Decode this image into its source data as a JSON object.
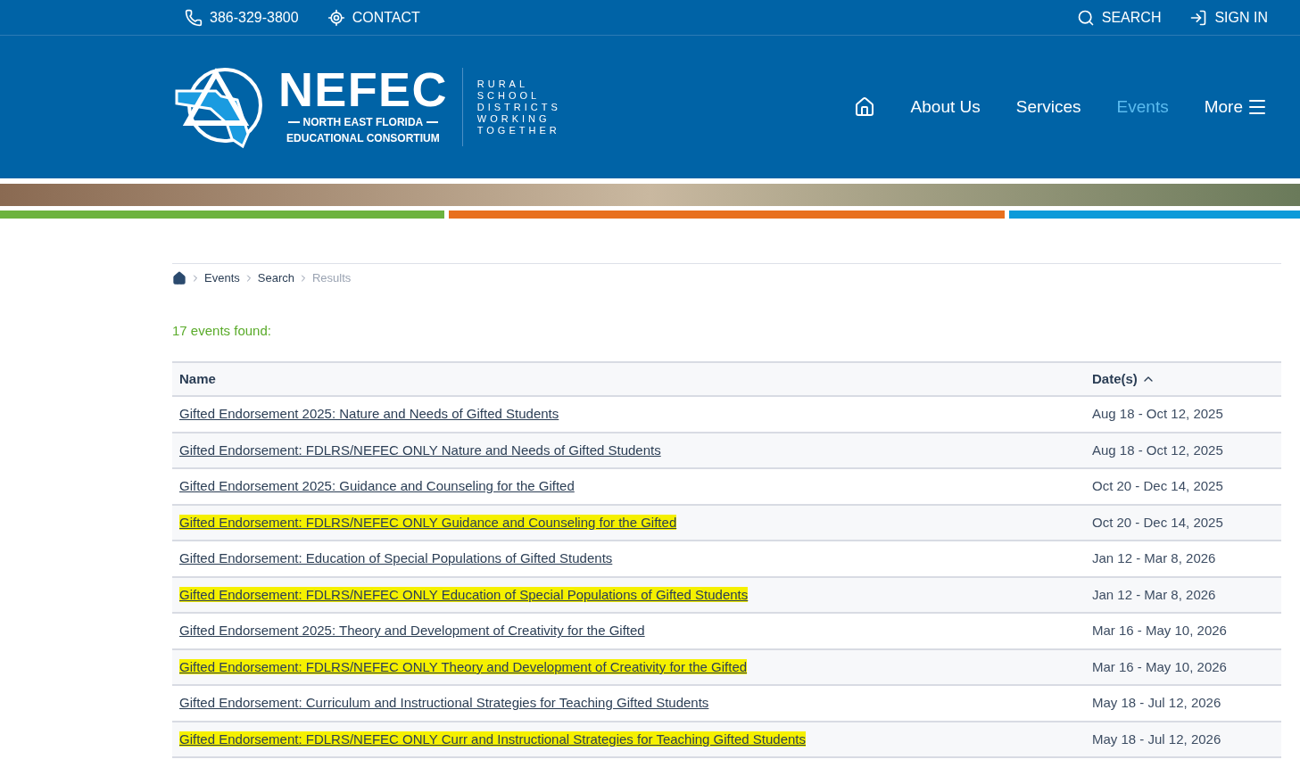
{
  "top_bar": {
    "phone": "386-329-3800",
    "contact": "CONTACT",
    "search": "SEARCH",
    "sign_in": "SIGN IN"
  },
  "logo": {
    "name": "NEFEC",
    "line_1": "NORTH EAST FLORIDA",
    "line_2": "EDUCATIONAL CONSORTIUM",
    "tagline": [
      "RURAL",
      "SCHOOL",
      "DISTRICTS",
      "WORKING",
      "TOGETHER"
    ]
  },
  "nav": [
    {
      "label": "About Us",
      "selected": false
    },
    {
      "label": "Services",
      "selected": false
    },
    {
      "label": "Events",
      "selected": true
    },
    {
      "label": "More",
      "selected": false
    }
  ],
  "breadcrumb": [
    {
      "label": "Events",
      "current": false
    },
    {
      "label": "Search",
      "current": false
    },
    {
      "label": "Results",
      "current": true
    }
  ],
  "result_count": "17 events found:",
  "table": {
    "columns": [
      "Name",
      "Date(s)"
    ],
    "rows": [
      {
        "name": "Gifted Endorsement 2025: Nature and Needs of Gifted Students",
        "dates": "Aug 18 - Oct 12, 2025",
        "highlighted": false
      },
      {
        "name": "Gifted Endorsement: FDLRS/NEFEC ONLY Nature and Needs of Gifted Students",
        "dates": "Aug 18 - Oct 12, 2025",
        "highlighted": false
      },
      {
        "name": "Gifted Endorsement 2025: Guidance and Counseling for the Gifted",
        "dates": "Oct 20 - Dec 14, 2025",
        "highlighted": false
      },
      {
        "name": "Gifted Endorsement: FDLRS/NEFEC ONLY Guidance and Counseling for the Gifted",
        "dates": "Oct 20 - Dec 14, 2025",
        "highlighted": true
      },
      {
        "name": "Gifted Endorsement: Education of Special Populations of Gifted Students",
        "dates": "Jan 12 - Mar 8, 2026",
        "highlighted": false
      },
      {
        "name": "Gifted Endorsement: FDLRS/NEFEC ONLY Education of Special Populations of Gifted Students",
        "dates": "Jan 12 - Mar 8, 2026",
        "highlighted": true
      },
      {
        "name": "Gifted Endorsement 2025: Theory and Development of Creativity for the Gifted",
        "dates": "Mar 16 - May 10, 2026",
        "highlighted": false
      },
      {
        "name": "Gifted Endorsement: FDLRS/NEFEC ONLY Theory and Development of Creativity for the Gifted",
        "dates": "Mar 16 - May 10, 2026",
        "highlighted": true
      },
      {
        "name": "Gifted Endorsement: Curriculum and Instructional Strategies for Teaching Gifted Students",
        "dates": "May 18 - Jul 12, 2026",
        "highlighted": false
      },
      {
        "name": "Gifted Endorsement: FDLRS/NEFEC ONLY Curr and Instructional Strategies for Teaching Gifted Students",
        "dates": "May 18 - Jul 12, 2026",
        "highlighted": true
      }
    ]
  }
}
